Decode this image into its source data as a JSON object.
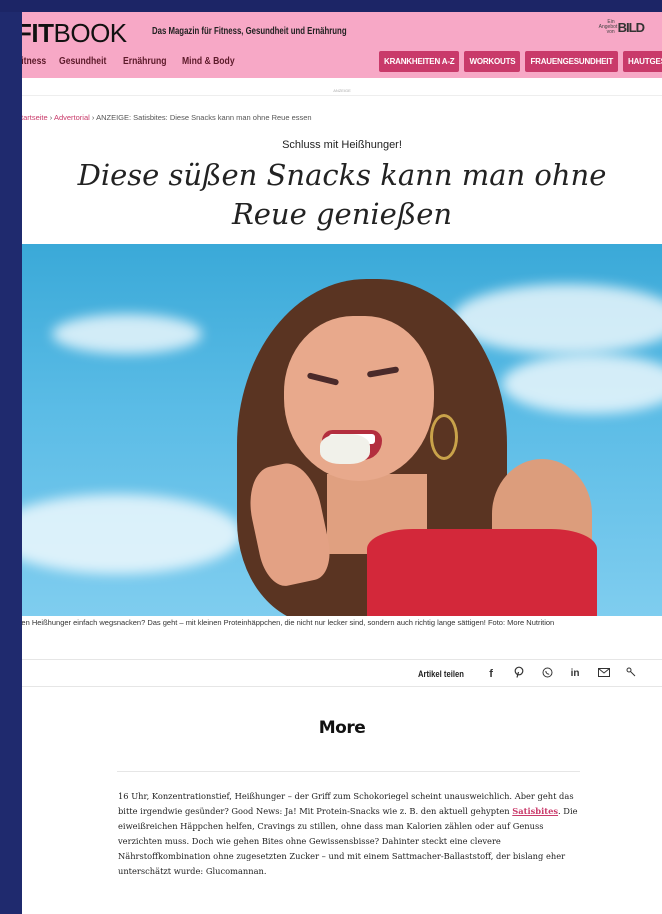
{
  "header": {
    "logo_bold": "FIT",
    "logo_thin": "BOOK",
    "tagline": "Das Magazin für Fitness, Gesundheit und Ernährung",
    "partner_small": "Ein Angebot von",
    "partner_logo": "BILD"
  },
  "nav": {
    "items": [
      "Fitness",
      "Gesundheit",
      "Ernährung",
      "Mind & Body"
    ],
    "pills": [
      "KRANKHEITEN A-Z",
      "WORKOUTS",
      "FRAUENGESUNDHEIT",
      "HAUTGESUNDHEIT"
    ]
  },
  "ad_label": "ANZEIGE",
  "breadcrumb": {
    "home": "Startseite",
    "section": "Advertorial",
    "current": "ANZEIGE: Satisbites: Diese Snacks kann man ohne Reue essen"
  },
  "article": {
    "kicker": "Schluss mit Heißhunger!",
    "headline": "Diese süßen Snacks kann man ohne Reue genießen",
    "caption": "Den Heißhunger einfach wegsnacken? Das geht – mit kleinen Proteinhäppchen, die nicht nur lecker sind, sondern auch richtig lange sättigen! Foto: More Nutrition",
    "body_before_link": "16 Uhr, Konzentrationstief, Heißhunger – der Griff zum Schokoriegel scheint unausweichlich. Aber geht das bitte irgendwie gesünder? Good News: Ja! Mit Protein-Snacks wie z. B. den aktuell gehypten ",
    "body_link": "Satisbites",
    "body_after_link": ". Die eiweißreichen Häppchen helfen, Cravings zu stillen, ohne dass man Kalorien zählen oder auf Genuss verzichten muss. Doch wie gehen Bites ohne Gewissensbisse? Dahinter steckt eine clevere Nährstoffkombination ohne zugesetzten Zucker – und mit einem Sattmacher-Ballaststoff, der bislang eher unterschätzt wurde: Glucomannan."
  },
  "share": {
    "label": "Artikel teilen",
    "icons": [
      "facebook-icon",
      "pinterest-icon",
      "whatsapp-icon",
      "linkedin-icon",
      "mail-icon",
      "link-icon"
    ]
  },
  "brand": "More",
  "colors": {
    "masthead": "#f7a8c6",
    "accent": "#c93a6a",
    "nav_text": "#5c1a2a"
  }
}
